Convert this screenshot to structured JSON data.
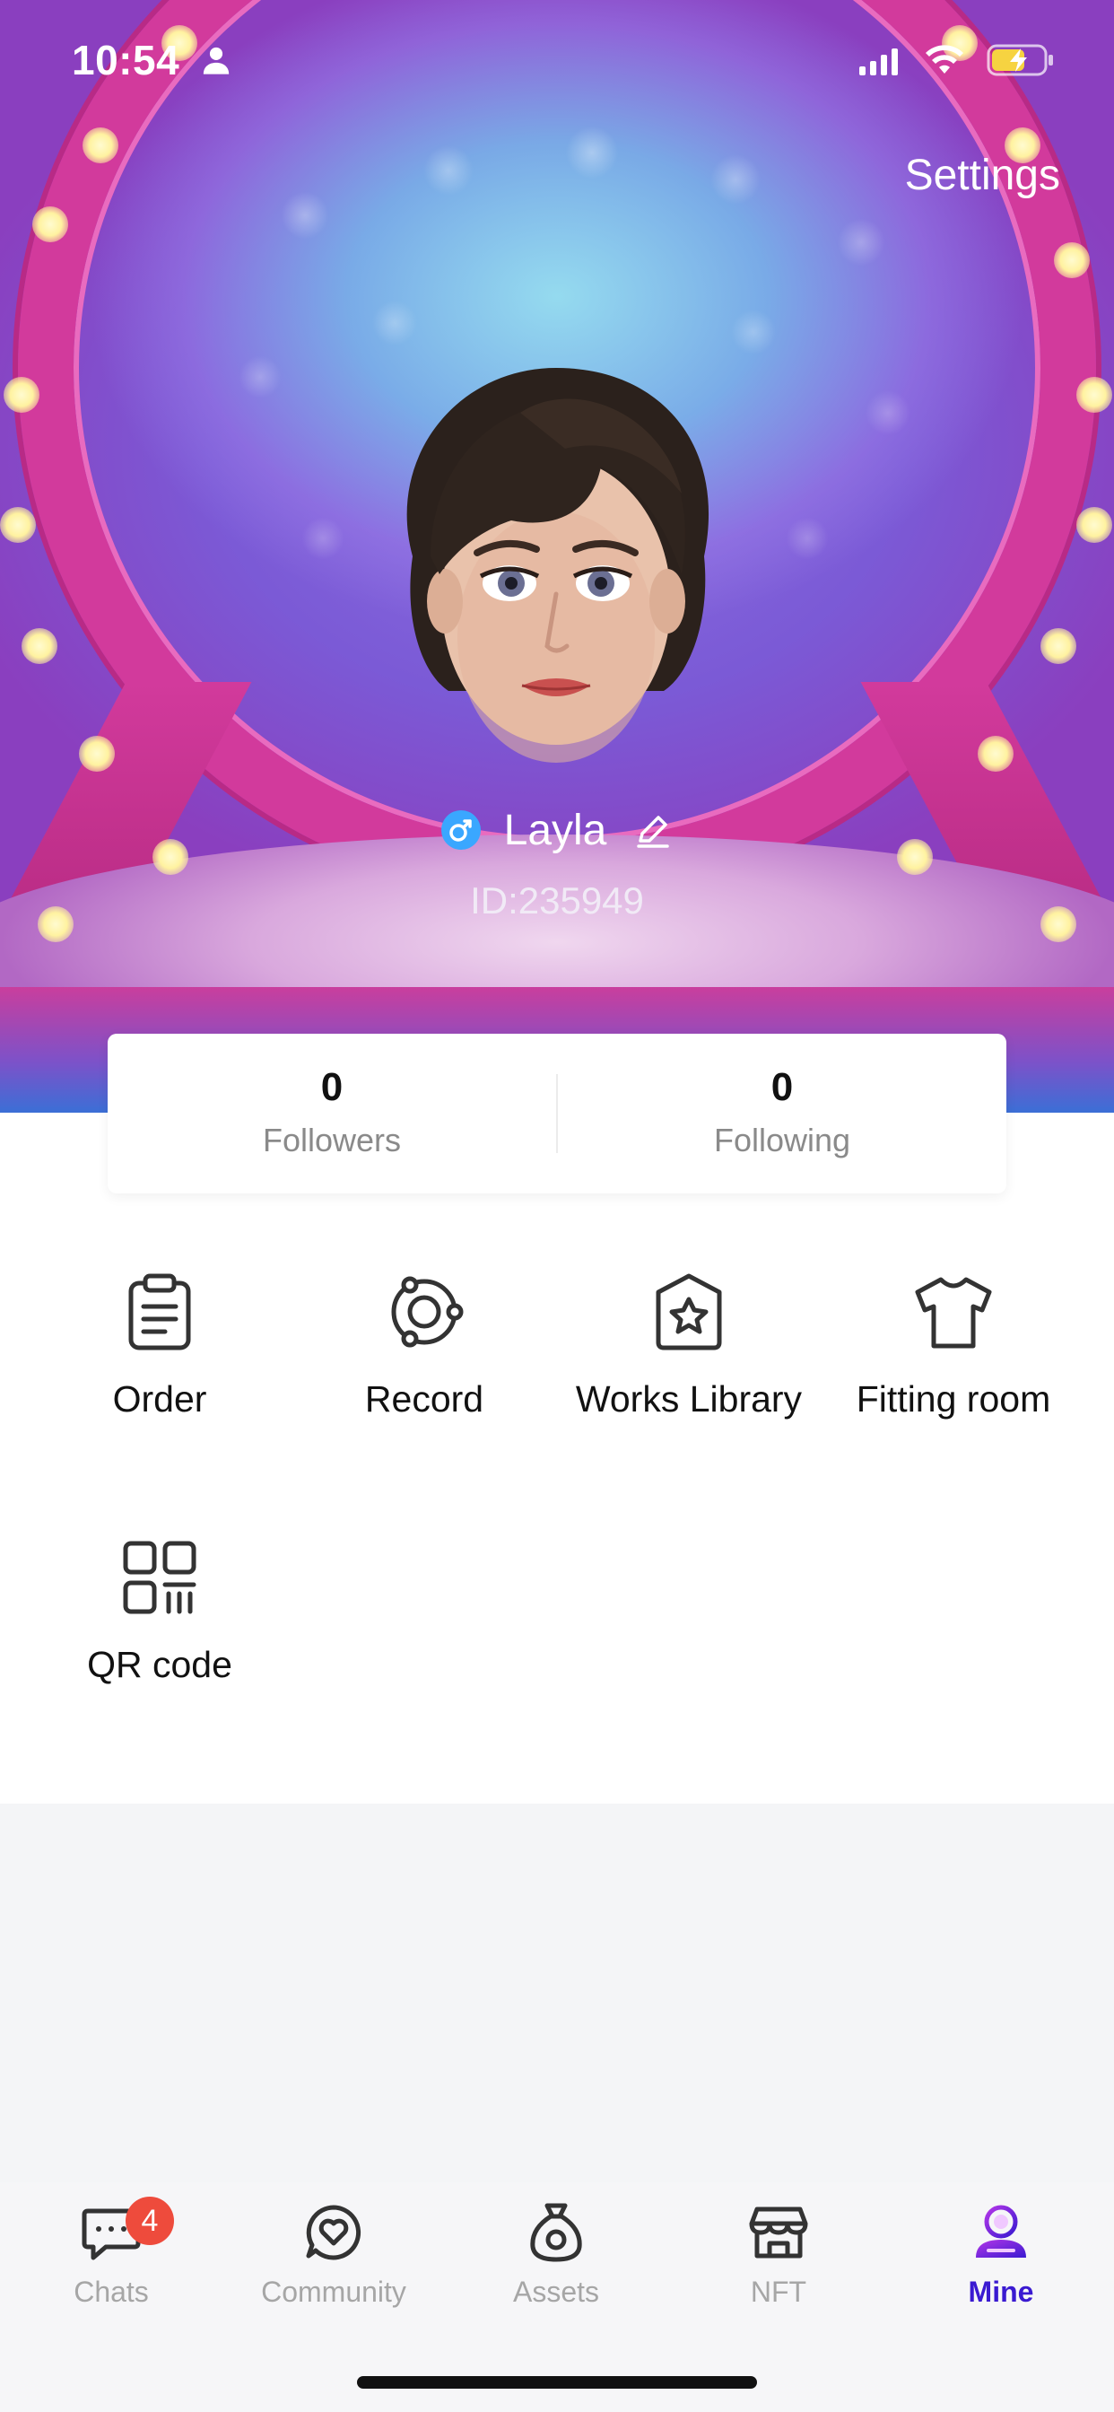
{
  "status_bar": {
    "time": "10:54"
  },
  "header": {
    "settings_label": "Settings"
  },
  "profile": {
    "username": "Layla",
    "user_id": "ID:235949"
  },
  "stats": {
    "followers": {
      "value": "0",
      "label": "Followers"
    },
    "following": {
      "value": "0",
      "label": "Following"
    }
  },
  "menu": {
    "order": "Order",
    "record": "Record",
    "works_library": "Works Library",
    "fitting_room": "Fitting room",
    "qr_code": "QR code"
  },
  "tab_bar": {
    "chats": {
      "label": "Chats",
      "badge": "4"
    },
    "community": {
      "label": "Community"
    },
    "assets": {
      "label": "Assets"
    },
    "nft": {
      "label": "NFT"
    },
    "mine": {
      "label": "Mine"
    }
  },
  "colors": {
    "accent": "#3a1ad1",
    "badge": "#ee4b3c",
    "gender": "#3aa7ff"
  }
}
